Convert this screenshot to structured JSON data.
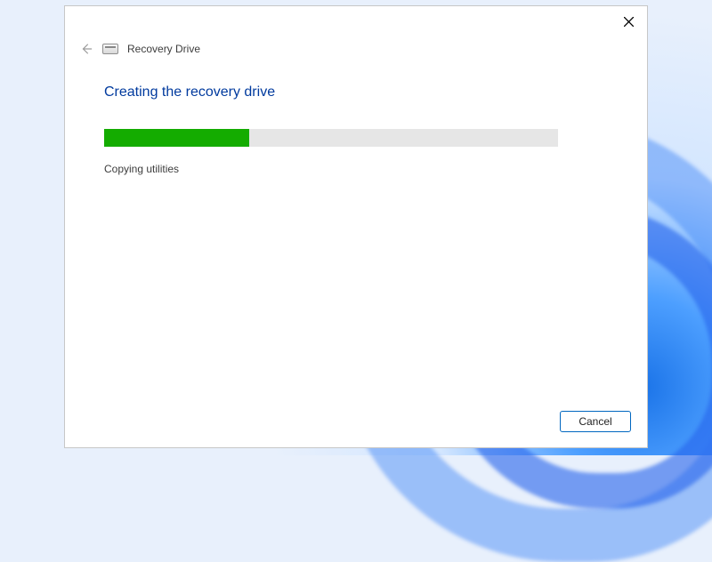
{
  "window": {
    "title": "Recovery Drive",
    "heading": "Creating the recovery drive",
    "status": "Copying utilities",
    "progress_percent": 32,
    "accent_color": "#003a9e",
    "progress_color": "#14ac00"
  },
  "buttons": {
    "cancel": "Cancel"
  }
}
